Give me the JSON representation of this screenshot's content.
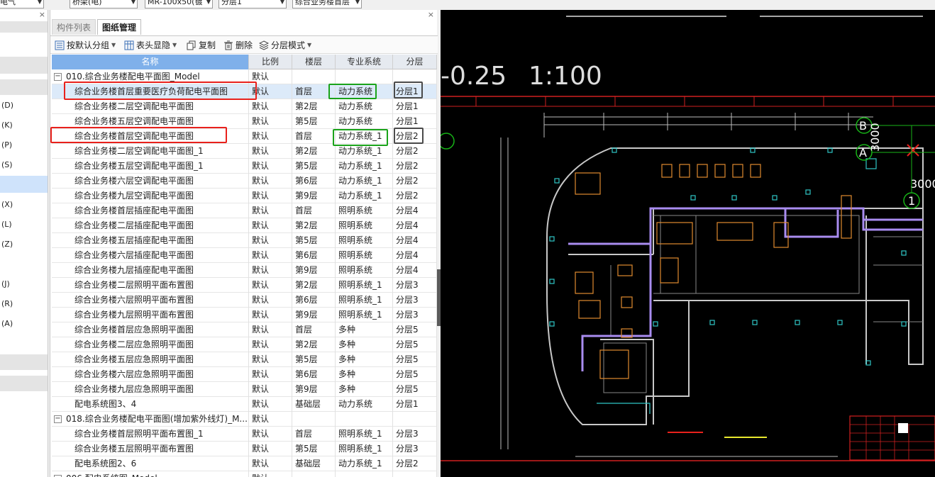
{
  "top_dropdowns": [
    {
      "label": "电气"
    },
    {
      "label": "桥架(电)"
    },
    {
      "label": "MR-100x50(镀"
    },
    {
      "label": "分层1"
    },
    {
      "label": "综合业务楼首层"
    }
  ],
  "left_panel": {
    "close": "×",
    "items": [
      "(D)",
      "(K)",
      "(P)",
      "(S)",
      "(X)",
      "(L)",
      "(Z)",
      "(J)",
      "(R)",
      "(A)"
    ]
  },
  "center": {
    "close": "×",
    "tabs": [
      {
        "label": "构件列表"
      },
      {
        "label": "图纸管理"
      }
    ],
    "toolbar": {
      "group": "按默认分组",
      "header_show": "表头显隐",
      "copy": "复制",
      "delete": "删除",
      "layer_mode": "分层模式"
    },
    "columns": [
      "名称",
      "比例",
      "楼层",
      "专业系统",
      "分层"
    ],
    "rows": [
      {
        "group": true,
        "name": "010.综合业务楼配电平面图_Model",
        "scale": "默认",
        "floor": "",
        "system": "",
        "layer": ""
      },
      {
        "name": "综合业务楼首层重要医疗负荷配电平面图",
        "scale": "默认",
        "floor": "首层",
        "system": "动力系统",
        "layer": "分层1",
        "selected": true
      },
      {
        "name": "综合业务楼二层空调配电平面图",
        "scale": "默认",
        "floor": "第2层",
        "system": "动力系统",
        "layer": "分层1"
      },
      {
        "name": "综合业务楼五层空调配电平面图",
        "scale": "默认",
        "floor": "第5层",
        "system": "动力系统",
        "layer": "分层1"
      },
      {
        "name": "综合业务楼首层空调配电平面图",
        "scale": "默认",
        "floor": "首层",
        "system": "动力系统_1",
        "layer": "分层2"
      },
      {
        "name": "综合业务楼二层空调配电平面图_1",
        "scale": "默认",
        "floor": "第2层",
        "system": "动力系统_1",
        "layer": "分层2"
      },
      {
        "name": "综合业务楼五层空调配电平面图_1",
        "scale": "默认",
        "floor": "第5层",
        "system": "动力系统_1",
        "layer": "分层2"
      },
      {
        "name": "综合业务楼六层空调配电平面图",
        "scale": "默认",
        "floor": "第6层",
        "system": "动力系统_1",
        "layer": "分层2"
      },
      {
        "name": "综合业务楼九层空调配电平面图",
        "scale": "默认",
        "floor": "第9层",
        "system": "动力系统_1",
        "layer": "分层2"
      },
      {
        "name": "综合业务楼首层插座配电平面图",
        "scale": "默认",
        "floor": "首层",
        "system": "照明系统",
        "layer": "分层4"
      },
      {
        "name": "综合业务楼二层插座配电平面图",
        "scale": "默认",
        "floor": "第2层",
        "system": "照明系统",
        "layer": "分层4"
      },
      {
        "name": "综合业务楼五层插座配电平面图",
        "scale": "默认",
        "floor": "第5层",
        "system": "照明系统",
        "layer": "分层4"
      },
      {
        "name": "综合业务楼六层插座配电平面图",
        "scale": "默认",
        "floor": "第6层",
        "system": "照明系统",
        "layer": "分层4"
      },
      {
        "name": "综合业务楼九层插座配电平面图",
        "scale": "默认",
        "floor": "第9层",
        "system": "照明系统",
        "layer": "分层4"
      },
      {
        "name": "综合业务楼二层照明平面布置图",
        "scale": "默认",
        "floor": "第2层",
        "system": "照明系统_1",
        "layer": "分层3"
      },
      {
        "name": "综合业务楼六层照明平面布置图",
        "scale": "默认",
        "floor": "第6层",
        "system": "照明系统_1",
        "layer": "分层3"
      },
      {
        "name": "综合业务楼九层照明平面布置图",
        "scale": "默认",
        "floor": "第9层",
        "system": "照明系统_1",
        "layer": "分层3"
      },
      {
        "name": "综合业务楼首层应急照明平面图",
        "scale": "默认",
        "floor": "首层",
        "system": "多种",
        "layer": "分层5"
      },
      {
        "name": "综合业务楼二层应急照明平面图",
        "scale": "默认",
        "floor": "第2层",
        "system": "多种",
        "layer": "分层5"
      },
      {
        "name": "综合业务楼五层应急照明平面图",
        "scale": "默认",
        "floor": "第5层",
        "system": "多种",
        "layer": "分层5"
      },
      {
        "name": "综合业务楼六层应急照明平面图",
        "scale": "默认",
        "floor": "第6层",
        "system": "多种",
        "layer": "分层5"
      },
      {
        "name": "综合业务楼九层应急照明平面图",
        "scale": "默认",
        "floor": "第9层",
        "system": "多种",
        "layer": "分层5"
      },
      {
        "name": "配电系统图3、4",
        "scale": "默认",
        "floor": "基础层",
        "system": "动力系统",
        "layer": "分层1"
      },
      {
        "group": true,
        "name": "018.综合业务楼配电平面图(增加紫外线灯)_M...",
        "scale": "默认",
        "floor": "",
        "system": "",
        "layer": ""
      },
      {
        "name": "综合业务楼首层照明平面布置图_1",
        "scale": "默认",
        "floor": "首层",
        "system": "照明系统_1",
        "layer": "分层3"
      },
      {
        "name": "综合业务楼五层照明平面布置图",
        "scale": "默认",
        "floor": "第5层",
        "system": "照明系统_1",
        "layer": "分层3"
      },
      {
        "name": "配电系统图2、6",
        "scale": "默认",
        "floor": "基础层",
        "system": "动力系统_1",
        "layer": "分层2"
      },
      {
        "group": true,
        "name": "006.配电系统图_Model",
        "scale": "默认",
        "floor": "",
        "system": "",
        "layer": ""
      }
    ]
  },
  "cad": {
    "scale_text": "1:100",
    "elev_text": "-0.25",
    "grid_labels": [
      "B",
      "A",
      "1"
    ],
    "dim_labels": [
      "3000",
      "3000"
    ],
    "colors": {
      "background": "#000000",
      "wall": "#c8c8c8",
      "route": "#a98cf0",
      "axis": "#d02020",
      "furniture": "#e08a2e",
      "device": "#2fc6c6",
      "grid_bubble": "#17b317"
    }
  },
  "annotation_colors": {
    "red": "#e8211c",
    "green": "#1aa31a",
    "dark": "#4a4a4a"
  }
}
